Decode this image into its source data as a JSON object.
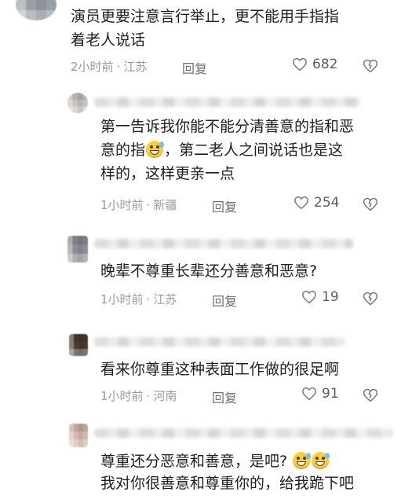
{
  "comments": [
    {
      "content": "演员更要注意言行举止，更不能用手指指\n着老人说话",
      "time": "2小时前",
      "location": "江苏",
      "reply_label": "回复",
      "likes": "682",
      "avatar_color": "#9aa0a6"
    },
    {
      "content_parts": [
        "第一告诉我你能不能分清善意的指和恶\n意的指",
        "，第二老人之间说话也是这\n样的，这样更亲一点"
      ],
      "time": "1小时前",
      "location": "新疆",
      "reply_label": "回复",
      "likes": "254",
      "avatar_color": "#c9c4c0"
    },
    {
      "content": "晚辈不尊重长辈还分善意和恶意?",
      "time": "1小时前",
      "location": "江苏",
      "reply_label": "回复",
      "likes": "19",
      "avatar_color": "#8c8f96"
    },
    {
      "content": "看来你尊重这种表面工作做的很足啊",
      "time": "1小时前",
      "location": "河南",
      "reply_label": "回复",
      "likes": "91",
      "avatar_color": "#4a3a2e"
    },
    {
      "content_line1": "尊重还分恶意和善意，是吧?",
      "content_line2": "我对你很善意和尊重你的，给我跪下吧",
      "avatar_color": "#d4b8b0"
    }
  ],
  "separator": "·",
  "icons": {
    "like": "heart-outline-icon",
    "dislike": "broken-heart-icon",
    "emoji": "grinning-sweat-emoji"
  }
}
